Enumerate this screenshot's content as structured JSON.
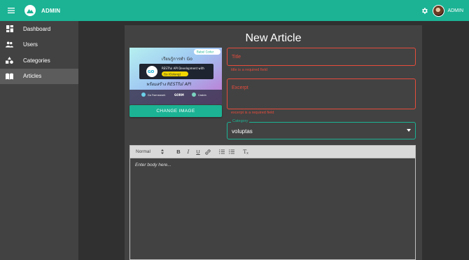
{
  "appbar": {
    "title": "ADMIN",
    "user_name": "ADMIN",
    "color": "#1bb394"
  },
  "sidebar": {
    "items": [
      {
        "label": "Dashboard",
        "icon": "dashboard-icon"
      },
      {
        "label": "Users",
        "icon": "users-icon"
      },
      {
        "label": "Categories",
        "icon": "categories-icon"
      },
      {
        "label": "Articles",
        "icon": "articles-icon",
        "active": true
      }
    ]
  },
  "page": {
    "title": "New Article"
  },
  "banner": {
    "badge": "Babel Coder",
    "heading": "เรียนรู้การทำ Go",
    "course_line1": "RESTful API Development with",
    "course_line2": "Go (Golang)",
    "subheading": "พร้อมสร้าง RESTful API",
    "tech1": "Go Framework",
    "tech2": "GORM",
    "tech3": "Casbin"
  },
  "change_image_label": "CHANGE IMAGE",
  "form": {
    "title_label": "Title",
    "title_error": "title is a required field",
    "excerpt_label": "Excerpt",
    "excerpt_error": "excerpt is a required field",
    "category_label": "Category",
    "category_value": "voluptas"
  },
  "editor": {
    "format_value": "Normal",
    "bold": "B",
    "italic": "I",
    "underline": "U",
    "clean": "T",
    "placeholder": "Enter body here..."
  },
  "colors": {
    "accent": "#1bb394",
    "error": "#e74c3c",
    "sidebar": "#424242",
    "background": "#303030"
  }
}
